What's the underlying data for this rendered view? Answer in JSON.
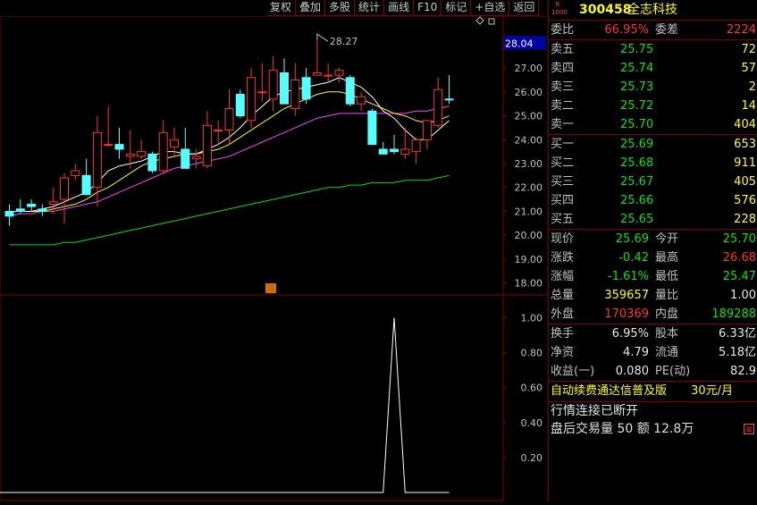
{
  "toolbar": {
    "buttons": [
      "复权",
      "叠加",
      "多股",
      "统计",
      "画线",
      "F10",
      "标记",
      "+自选",
      "返回"
    ]
  },
  "stock": {
    "code": "300458",
    "name": "全志科技",
    "badge": "R 1000"
  },
  "committee": {
    "ratio_label": "委比",
    "ratio_value": "66.95%",
    "diff_label": "委差",
    "diff_value": "2224"
  },
  "asks": [
    {
      "label": "卖五",
      "price": "25.75",
      "vol": "72"
    },
    {
      "label": "卖四",
      "price": "25.74",
      "vol": "57"
    },
    {
      "label": "卖三",
      "price": "25.73",
      "vol": "2"
    },
    {
      "label": "卖二",
      "price": "25.72",
      "vol": "14"
    },
    {
      "label": "卖一",
      "price": "25.70",
      "vol": "404"
    }
  ],
  "bids": [
    {
      "label": "买一",
      "price": "25.69",
      "vol": "653"
    },
    {
      "label": "买二",
      "price": "25.68",
      "vol": "911"
    },
    {
      "label": "买三",
      "price": "25.67",
      "vol": "405"
    },
    {
      "label": "买四",
      "price": "25.66",
      "vol": "576"
    },
    {
      "label": "买五",
      "price": "25.65",
      "vol": "228"
    }
  ],
  "stats1": [
    {
      "l1": "现价",
      "v1": "25.69",
      "c1": "green",
      "l2": "今开",
      "v2": "25.70",
      "c2": "green"
    },
    {
      "l1": "涨跌",
      "v1": "-0.42",
      "c1": "green",
      "l2": "最高",
      "v2": "26.68",
      "c2": "red"
    },
    {
      "l1": "涨幅",
      "v1": "-1.61%",
      "c1": "green",
      "l2": "最低",
      "v2": "25.47",
      "c2": "green"
    },
    {
      "l1": "总量",
      "v1": "359657",
      "c1": "yellow",
      "l2": "量比",
      "v2": "1.00",
      "c2": "white"
    },
    {
      "l1": "外盘",
      "v1": "170369",
      "c1": "red",
      "l2": "内盘",
      "v2": "189288",
      "c2": "green"
    }
  ],
  "stats2": [
    {
      "l1": "换手",
      "v1": "6.95%",
      "c1": "white",
      "l2": "股本",
      "v2": "6.33亿",
      "c2": "white"
    },
    {
      "l1": "净资",
      "v1": "4.79",
      "c1": "white",
      "l2": "流通",
      "v2": "5.18亿",
      "c2": "white"
    },
    {
      "l1": "收益(一)",
      "v1": "0.080",
      "c1": "white",
      "l2": "PE(动)",
      "v2": "82.9",
      "c2": "white"
    }
  ],
  "banner": {
    "text": "自动续费通达信普及版",
    "price": "30元/月"
  },
  "messages": [
    "行情连接已断开",
    "盘后交易量 50 额 12.8万"
  ],
  "chart_data": [
    {
      "type": "candlestick",
      "current_price_label": "28.04",
      "max_annotation": "28.27",
      "pre_marker": "预",
      "ylim": [
        17.5,
        28.8
      ],
      "yticks": [
        "28.00",
        "27.00",
        "26.00",
        "25.00",
        "24.00",
        "23.00",
        "22.00",
        "21.00",
        "20.00",
        "19.00",
        "18.00"
      ],
      "ytick_values": [
        28,
        27,
        26,
        25,
        24,
        23,
        22,
        21,
        20,
        19,
        18
      ],
      "colors": {
        "up": "#ff3232",
        "down": "#54ffff",
        "ma5": "#ffffff",
        "ma10": "#ffff00",
        "ma20": "#ff40ff",
        "ma60": "#00e000"
      },
      "candles": [
        {
          "o": 21.0,
          "h": 21.3,
          "l": 20.4,
          "c": 20.8
        },
        {
          "o": 21.1,
          "h": 21.5,
          "l": 20.9,
          "c": 21.0
        },
        {
          "o": 21.3,
          "h": 21.5,
          "l": 21.0,
          "c": 21.2
        },
        {
          "o": 21.1,
          "h": 21.3,
          "l": 20.8,
          "c": 21.0
        },
        {
          "o": 21.3,
          "h": 22.0,
          "l": 20.9,
          "c": 21.4
        },
        {
          "o": 21.5,
          "h": 22.6,
          "l": 20.5,
          "c": 22.4
        },
        {
          "o": 22.5,
          "h": 23.0,
          "l": 22.3,
          "c": 22.7
        },
        {
          "o": 22.5,
          "h": 23.2,
          "l": 21.7,
          "c": 21.7
        },
        {
          "o": 22.0,
          "h": 25.0,
          "l": 21.2,
          "c": 24.3
        },
        {
          "o": 23.8,
          "h": 25.4,
          "l": 23.7,
          "c": 23.8
        },
        {
          "o": 23.8,
          "h": 24.5,
          "l": 23.2,
          "c": 23.6
        },
        {
          "o": 23.3,
          "h": 24.4,
          "l": 22.8,
          "c": 23.4
        },
        {
          "o": 23.3,
          "h": 24.0,
          "l": 23.2,
          "c": 23.5
        },
        {
          "o": 23.4,
          "h": 23.5,
          "l": 22.6,
          "c": 22.7
        },
        {
          "o": 22.7,
          "h": 24.8,
          "l": 22.6,
          "c": 24.3
        },
        {
          "o": 23.7,
          "h": 24.5,
          "l": 23.3,
          "c": 24.0
        },
        {
          "o": 23.6,
          "h": 24.5,
          "l": 22.8,
          "c": 22.8
        },
        {
          "o": 23.2,
          "h": 23.6,
          "l": 22.8,
          "c": 23.3
        },
        {
          "o": 22.9,
          "h": 25.2,
          "l": 22.8,
          "c": 24.6
        },
        {
          "o": 24.4,
          "h": 24.8,
          "l": 23.8,
          "c": 24.4
        },
        {
          "o": 24.4,
          "h": 26.1,
          "l": 23.8,
          "c": 25.3
        },
        {
          "o": 25.9,
          "h": 26.1,
          "l": 24.9,
          "c": 25.0
        },
        {
          "o": 24.8,
          "h": 27.0,
          "l": 24.5,
          "c": 26.6
        },
        {
          "o": 26.0,
          "h": 27.2,
          "l": 25.6,
          "c": 26.0
        },
        {
          "o": 25.7,
          "h": 27.5,
          "l": 25.2,
          "c": 26.9
        },
        {
          "o": 26.8,
          "h": 27.4,
          "l": 25.5,
          "c": 25.5
        },
        {
          "o": 25.3,
          "h": 27.2,
          "l": 25.0,
          "c": 26.5
        },
        {
          "o": 26.6,
          "h": 27.0,
          "l": 25.5,
          "c": 25.7
        },
        {
          "o": 26.7,
          "h": 28.27,
          "l": 26.7,
          "c": 26.8
        },
        {
          "o": 26.7,
          "h": 27.2,
          "l": 26.4,
          "c": 26.7
        },
        {
          "o": 26.7,
          "h": 27.0,
          "l": 26.4,
          "c": 26.9
        },
        {
          "o": 26.6,
          "h": 26.7,
          "l": 25.4,
          "c": 25.5
        },
        {
          "o": 25.5,
          "h": 26.0,
          "l": 25.2,
          "c": 25.8
        },
        {
          "o": 25.2,
          "h": 25.3,
          "l": 23.8,
          "c": 23.8
        },
        {
          "o": 23.6,
          "h": 23.9,
          "l": 23.4,
          "c": 23.4
        },
        {
          "o": 23.6,
          "h": 24.2,
          "l": 23.4,
          "c": 23.5
        },
        {
          "o": 23.4,
          "h": 24.5,
          "l": 23.2,
          "c": 23.6
        },
        {
          "o": 23.5,
          "h": 24.1,
          "l": 23.0,
          "c": 24.0
        },
        {
          "o": 24.0,
          "h": 24.8,
          "l": 23.6,
          "c": 24.8
        },
        {
          "o": 24.6,
          "h": 26.6,
          "l": 24.5,
          "c": 26.1
        },
        {
          "o": 25.7,
          "h": 26.7,
          "l": 25.5,
          "c": 25.69
        }
      ],
      "ma5": [
        21.0,
        21.0,
        21.0,
        21.1,
        21.2,
        21.4,
        21.6,
        21.8,
        22.2,
        22.7,
        22.9,
        23.0,
        23.1,
        23.3,
        23.5,
        23.5,
        23.4,
        23.4,
        23.6,
        23.8,
        24.1,
        24.5,
        25.0,
        25.4,
        25.8,
        26.0,
        26.1,
        26.2,
        26.3,
        26.4,
        26.6,
        26.4,
        26.2,
        25.8,
        25.2,
        24.9,
        24.4,
        24.0,
        24.0,
        24.4,
        24.8
      ],
      "ma10": [
        21.0,
        21.0,
        21.0,
        21.0,
        21.1,
        21.2,
        21.3,
        21.5,
        21.8,
        22.0,
        22.3,
        22.6,
        22.9,
        23.1,
        23.2,
        23.3,
        23.4,
        23.4,
        23.5,
        23.6,
        23.8,
        24.1,
        24.4,
        24.7,
        25.0,
        25.3,
        25.5,
        25.7,
        25.9,
        26.0,
        26.0,
        25.9,
        25.7,
        25.5,
        25.3,
        25.1,
        25.0,
        24.8,
        24.7,
        24.8,
        25.0
      ],
      "ma20": [
        20.8,
        20.9,
        20.9,
        21.0,
        21.0,
        21.1,
        21.2,
        21.3,
        21.4,
        21.6,
        21.8,
        22.0,
        22.2,
        22.4,
        22.6,
        22.8,
        22.9,
        23.0,
        23.1,
        23.2,
        23.3,
        23.5,
        23.7,
        23.9,
        24.1,
        24.3,
        24.5,
        24.7,
        24.9,
        25.0,
        25.1,
        25.1,
        25.1,
        25.1,
        25.1,
        25.1,
        25.1,
        25.2,
        25.2,
        25.3,
        25.4
      ],
      "ma60": [
        19.6,
        19.6,
        19.6,
        19.6,
        19.6,
        19.7,
        19.7,
        19.8,
        19.9,
        20.0,
        20.1,
        20.2,
        20.3,
        20.4,
        20.5,
        20.6,
        20.7,
        20.8,
        20.9,
        21.0,
        21.1,
        21.2,
        21.3,
        21.4,
        21.5,
        21.6,
        21.7,
        21.8,
        21.9,
        22.0,
        22.0,
        22.1,
        22.1,
        22.2,
        22.2,
        22.2,
        22.3,
        22.3,
        22.3,
        22.4,
        22.5
      ]
    },
    {
      "type": "line",
      "ylim": [
        0,
        1.1
      ],
      "yticks": [
        "1.00",
        "0.80",
        "0.60",
        "0.40",
        "0.20"
      ],
      "ytick_values": [
        1.0,
        0.8,
        0.6,
        0.4,
        0.2
      ],
      "color": "#ffffff",
      "values": [
        0,
        0,
        0,
        0,
        0,
        0,
        0,
        0,
        0,
        0,
        0,
        0,
        0,
        0,
        0,
        0,
        0,
        0,
        0,
        0,
        0,
        0,
        0,
        0,
        0,
        0,
        0,
        0,
        0,
        0,
        0,
        0,
        0,
        0,
        0,
        1,
        0,
        0,
        0,
        0,
        0
      ]
    }
  ]
}
